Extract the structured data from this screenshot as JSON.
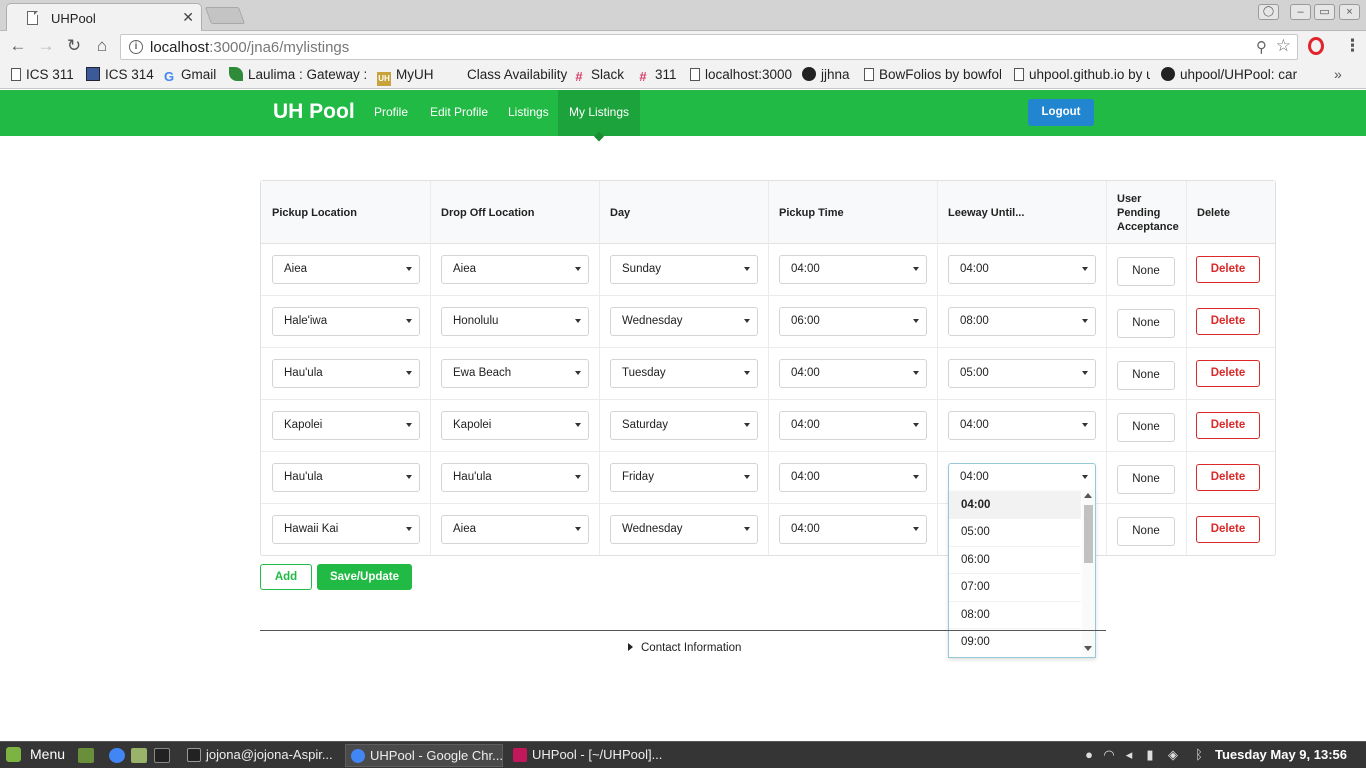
{
  "browser": {
    "tab_title": "UHPool",
    "close_glyph": "✕",
    "url_host": "localhost",
    "url_rest": ":3000/jna6/mylistings",
    "bookmarks": [
      {
        "label": "ICS 311",
        "icon": "page"
      },
      {
        "label": "ICS 314",
        "icon": "square"
      },
      {
        "label": "Gmail",
        "icon": "gmail"
      },
      {
        "label": "Laulima : Gateway : W",
        "icon": "leaf"
      },
      {
        "label": "MyUH",
        "icon": "uh"
      },
      {
        "label": "Class Availability",
        "icon": "none"
      },
      {
        "label": "Slack",
        "icon": "slack"
      },
      {
        "label": "311",
        "icon": "slack"
      },
      {
        "label": "localhost:3000",
        "icon": "page"
      },
      {
        "label": "jjhna",
        "icon": "gh"
      },
      {
        "label": "BowFolios by bowfolio",
        "icon": "page"
      },
      {
        "label": "uhpool.github.io by u",
        "icon": "page"
      },
      {
        "label": "uhpool/UHPool: car p",
        "icon": "gh"
      }
    ],
    "bookmarks_more": "»"
  },
  "app_nav": {
    "brand": "UH Pool",
    "items": [
      "Profile",
      "Edit Profile",
      "Listings",
      "My Listings"
    ],
    "active": "My Listings",
    "logout": "Logout",
    "colors": {
      "green": "#21ba45",
      "blue": "#2185d0"
    }
  },
  "table": {
    "headers": [
      "Pickup Location",
      "Drop Off Location",
      "Day",
      "Pickup Time",
      "Leeway Until...",
      "User Pending Acceptance",
      "Delete"
    ],
    "rows": [
      {
        "pickup": "Aiea",
        "dropoff": "Aiea",
        "day": "Sunday",
        "time": "04:00",
        "leeway": "04:00",
        "pending": "None",
        "delete": "Delete"
      },
      {
        "pickup": "Hale'iwa",
        "dropoff": "Honolulu",
        "day": "Wednesday",
        "time": "06:00",
        "leeway": "08:00",
        "pending": "None",
        "delete": "Delete"
      },
      {
        "pickup": "Hau'ula",
        "dropoff": "Ewa Beach",
        "day": "Tuesday",
        "time": "04:00",
        "leeway": "05:00",
        "pending": "None",
        "delete": "Delete"
      },
      {
        "pickup": "Kapolei",
        "dropoff": "Kapolei",
        "day": "Saturday",
        "time": "04:00",
        "leeway": "04:00",
        "pending": "None",
        "delete": "Delete"
      },
      {
        "pickup": "Hau'ula",
        "dropoff": "Hau'ula",
        "day": "Friday",
        "time": "04:00",
        "leeway": "04:00",
        "pending": "None",
        "delete": "Delete"
      },
      {
        "pickup": "Hawaii Kai",
        "dropoff": "Aiea",
        "day": "Wednesday",
        "time": "04:00",
        "leeway": "",
        "pending": "None",
        "delete": "Delete"
      }
    ],
    "open_dropdown": {
      "row": 5,
      "options": [
        "04:00",
        "05:00",
        "06:00",
        "07:00",
        "08:00",
        "09:00"
      ],
      "selected": "04:00"
    }
  },
  "actions": {
    "add": "Add",
    "save": "Save/Update"
  },
  "footer": {
    "contact": "Contact Information"
  },
  "taskbar": {
    "menu": "Menu",
    "tasks": [
      {
        "label": "jojona@jojona-Aspir...",
        "icon_color": "#222222"
      },
      {
        "label": "UHPool - Google Chr...",
        "icon_color": "#4285f4"
      },
      {
        "label": "UHPool - [~/UHPool]...",
        "icon_color": "#c2185b"
      }
    ],
    "clock": "Tuesday May  9, 13:56"
  }
}
